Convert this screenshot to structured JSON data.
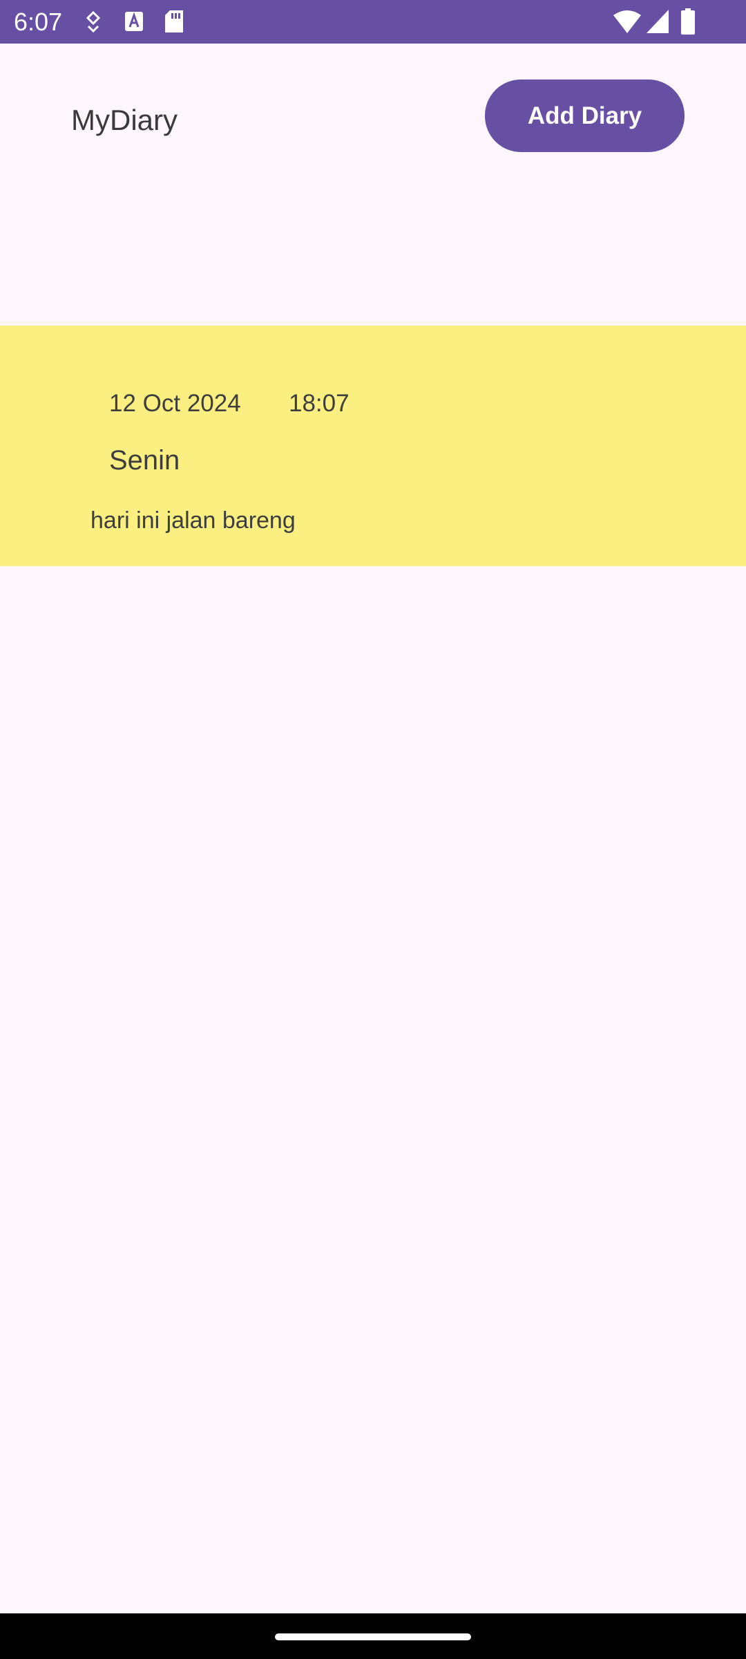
{
  "status_bar": {
    "time": "6:07",
    "background_color": "#6750a4",
    "icons": [
      "location-icon",
      "text-a-icon",
      "sd-card-icon",
      "wifi-icon",
      "signal-icon",
      "battery-icon"
    ]
  },
  "header": {
    "title": "MyDiary",
    "add_button_label": "Add Diary",
    "accent_color": "#6750a4"
  },
  "diary_list": {
    "items": [
      {
        "date": "12 Oct 2024",
        "time": "18:07",
        "title": "Senin",
        "content": "hari ini jalan bareng",
        "card_color": "#fbef81"
      }
    ]
  }
}
